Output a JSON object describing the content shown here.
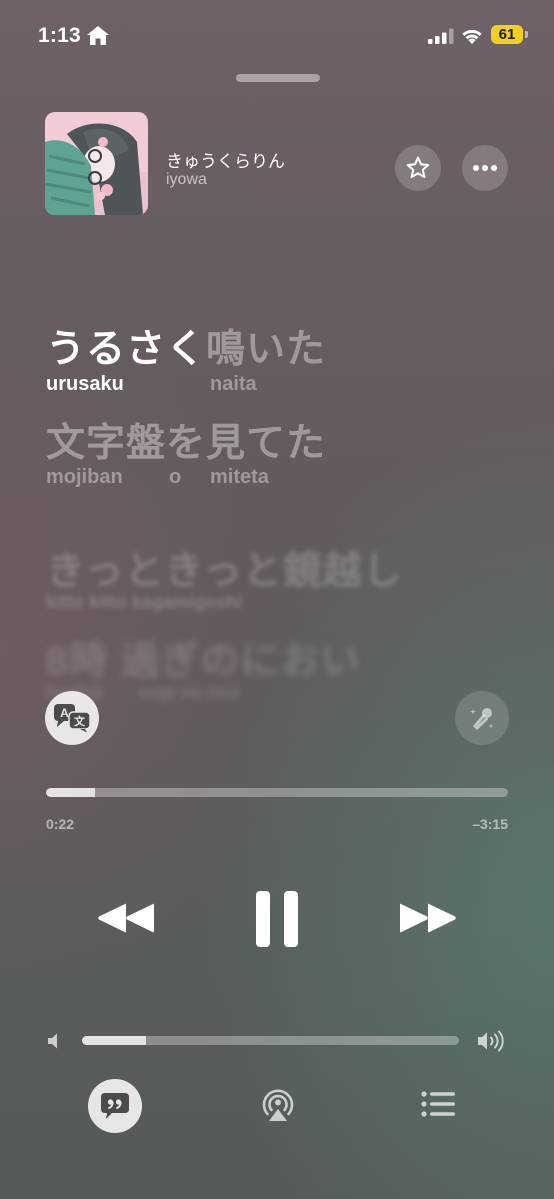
{
  "status_bar": {
    "time": "1:13",
    "battery": "61",
    "battery_color": "#f3cf1f"
  },
  "header": {
    "title": "きゅうくらりん",
    "artist": "iyowa",
    "icons": [
      "star-icon",
      "ellipsis-icon"
    ]
  },
  "lyrics": {
    "lines": [
      {
        "text_sung": "うるさく",
        "text_unsung": "鳴いた",
        "romaji": [
          "urusaku",
          "naita"
        ]
      },
      {
        "text": "文字盤を見てた",
        "romaji": [
          "mojiban",
          "o",
          "miteta"
        ]
      },
      {
        "text": "きっときっと鏡越し",
        "romaji": [
          "kitto kitto kagamigoshi"
        ]
      },
      {
        "text": "8時 過ぎのにおい",
        "romaji": [
          "hachiji",
          "sugi no nioi"
        ]
      }
    ]
  },
  "playback": {
    "elapsed": "0:22",
    "remaining": "–3:15",
    "progress": 0.105
  },
  "volume": {
    "level": 0.17
  },
  "controls": {
    "icons": [
      "rewind-icon",
      "pause-icon",
      "fast-forward-icon",
      "translate-icon",
      "sing-icon",
      "lyrics-icon",
      "airplay-icon",
      "queue-icon"
    ]
  }
}
